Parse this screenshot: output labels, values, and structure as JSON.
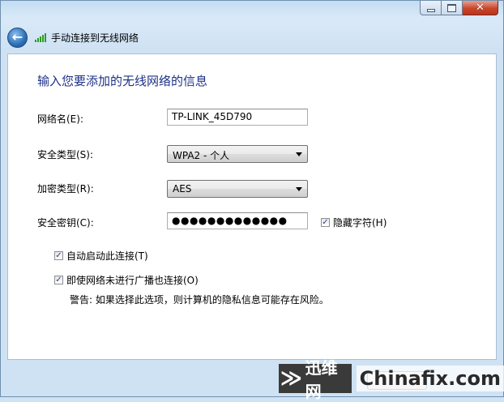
{
  "window": {
    "title": "手动连接到无线网络",
    "caption_buttons": {
      "close_glyph": "✕"
    }
  },
  "form": {
    "heading": "输入您要添加的无线网络的信息",
    "network_name": {
      "label": "网络名(E):",
      "value": "TP-LINK_45D790"
    },
    "security_type": {
      "label": "安全类型(S):",
      "value": "WPA2 - 个人"
    },
    "encryption_type": {
      "label": "加密类型(R):",
      "value": "AES"
    },
    "security_key": {
      "label": "安全密钥(C):",
      "value": "●●●●●●●●●●●●●"
    },
    "hide_chars": {
      "label": "隐藏字符(H)",
      "checked": true
    },
    "auto_start": {
      "label": "自动启动此连接(T)",
      "checked": true
    },
    "connect_even_if_not_broadcasting": {
      "label": "即使网络未进行广播也连接(O)",
      "checked": true
    },
    "warning": "警告: 如果选择此选项，则计算机的隐私信息可能存在风险。"
  },
  "watermark": {
    "logo": "≫",
    "cn": "迅维网",
    "en": "Chinafix.com"
  },
  "icons": {
    "back": "back-arrow-icon",
    "wireless": "wireless-signal-icon"
  }
}
